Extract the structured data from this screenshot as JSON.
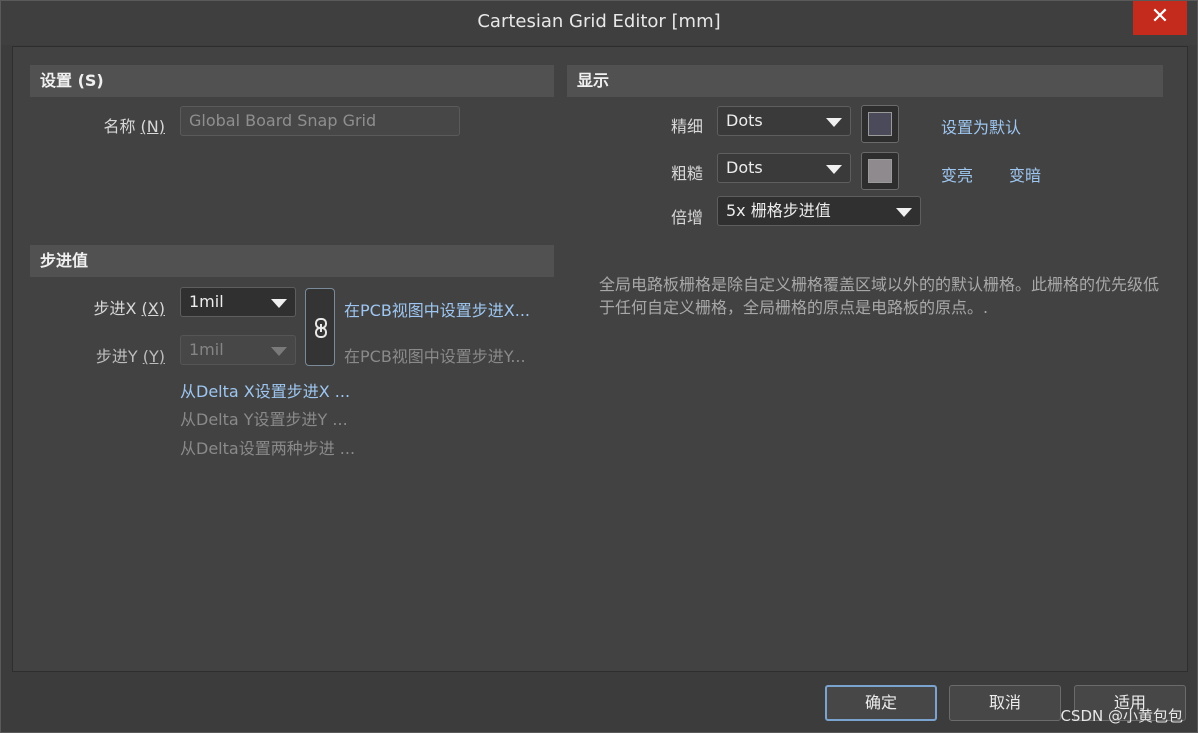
{
  "window": {
    "title": "Cartesian Grid Editor [mm]",
    "close_glyph": "✕"
  },
  "settings": {
    "heading": "设置 (S)",
    "name_label": "名称",
    "name_key": "(N)",
    "name_value": "Global Board Snap Grid"
  },
  "display": {
    "heading": "显示",
    "fine_label": "精细",
    "fine_value": "Dots",
    "fine_color": "#4a4a5a",
    "coarse_label": "粗糙",
    "coarse_value": "Dots",
    "coarse_color": "#8e8a8e",
    "multiplier_label": "倍增",
    "multiplier_value": "5x 栅格步进值",
    "set_default": "设置为默认",
    "lighter": "变亮",
    "darker": "变暗",
    "description": "全局电路板栅格是除自定义栅格覆盖区域以外的的默认栅格。此栅格的优先级低于任何自定义栅格，全局栅格的原点是电路板的原点。."
  },
  "step": {
    "heading": "步进值",
    "x_label": "步进X",
    "x_key": "(X)",
    "x_value": "1mil",
    "y_label": "步进Y",
    "y_key": "(Y)",
    "y_value": "1mil",
    "set_x_in_pcb": "在PCB视图中设置步进X...",
    "set_y_in_pcb": "在PCB视图中设置步进Y...",
    "from_delta_x": "从Delta X设置步进X ...",
    "from_delta_y": "从Delta Y设置步进Y ...",
    "from_delta_both": "从Delta设置两种步进 ..."
  },
  "buttons": {
    "ok": "确定",
    "cancel": "取消",
    "apply": "适用"
  },
  "watermark": "CSDN @小黄包包"
}
